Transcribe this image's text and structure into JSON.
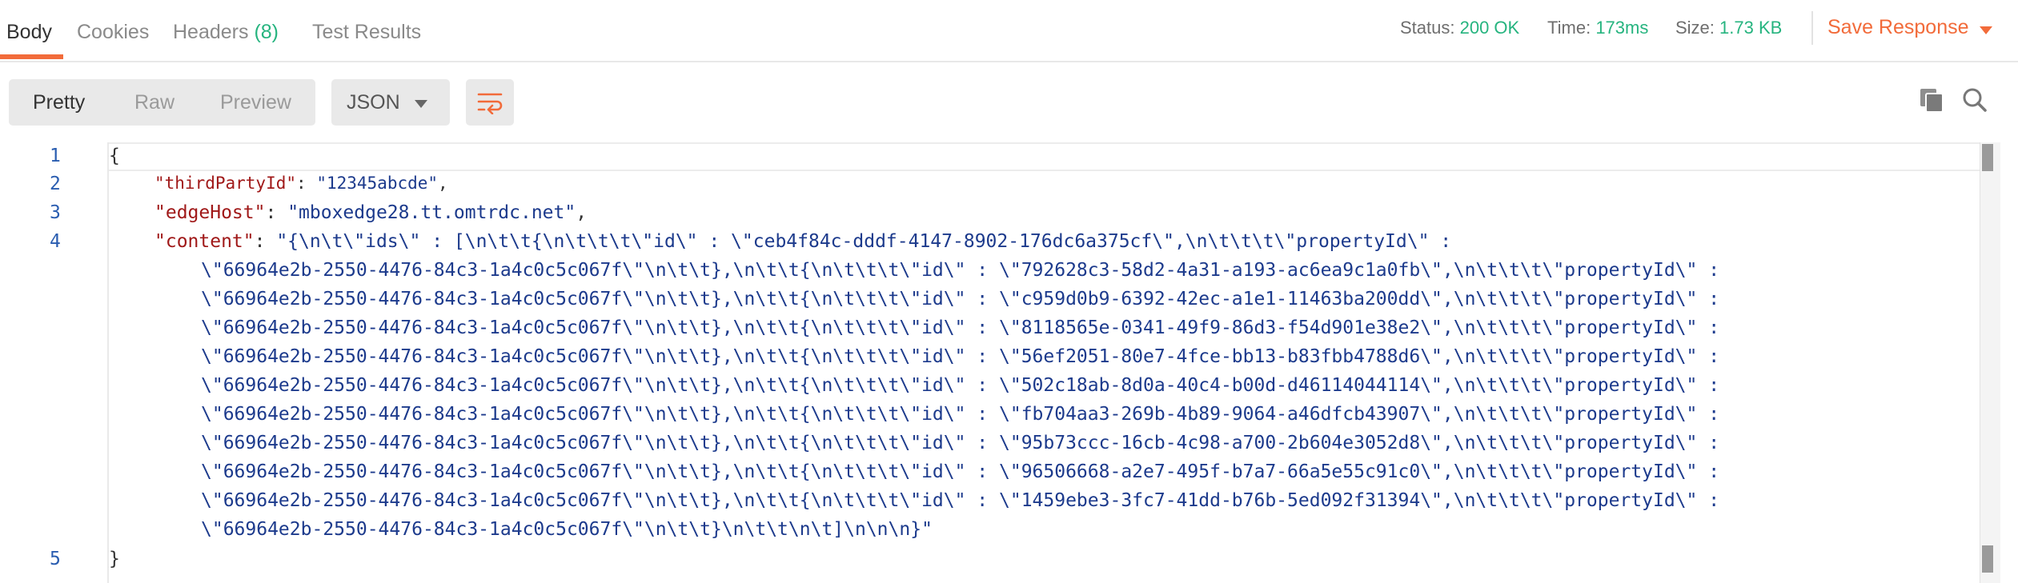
{
  "tabs": {
    "body": "Body",
    "cookies": "Cookies",
    "headers": "Headers",
    "headers_count": "(8)",
    "test_results": "Test Results"
  },
  "status": {
    "status_label": "Status:",
    "status_value": "200 OK",
    "time_label": "Time:",
    "time_value": "173ms",
    "size_label": "Size:",
    "size_value": "1.73 KB",
    "save_response": "Save Response"
  },
  "toolbar": {
    "pretty": "Pretty",
    "raw": "Raw",
    "preview": "Preview",
    "format": "JSON",
    "icons": [
      "wrap-lines-icon",
      "copy-icon",
      "search-icon"
    ]
  },
  "colors": {
    "accent": "#f26b3a",
    "success": "#26b47f",
    "json_key": "#a01919",
    "json_string": "#1c3a8c"
  },
  "editor": {
    "line_numbers": [
      "1",
      "2",
      "3",
      "4",
      "5"
    ],
    "open_brace": "{",
    "close_brace": "}",
    "line2_key": "\"thirdPartyId\"",
    "line2_value": "\"12345abcde\"",
    "line3_key": "\"edgeHost\"",
    "line3_value": "\"mboxedge28.tt.omtrdc.net\"",
    "line4_key": "\"content\"",
    "content_wrapped_lines": [
      "\"{\\n\\t\\\"ids\\\" : [\\n\\t\\t{\\n\\t\\t\\t\\\"id\\\" : \\\"ceb4f84c-dddf-4147-8902-176dc6a375cf\\\",\\n\\t\\t\\t\\\"propertyId\\\" :",
      "\\\"66964e2b-2550-4476-84c3-1a4c0c5c067f\\\"\\n\\t\\t},\\n\\t\\t{\\n\\t\\t\\t\\\"id\\\" : \\\"792628c3-58d2-4a31-a193-ac6ea9c1a0fb\\\",\\n\\t\\t\\t\\\"propertyId\\\" :",
      "\\\"66964e2b-2550-4476-84c3-1a4c0c5c067f\\\"\\n\\t\\t},\\n\\t\\t{\\n\\t\\t\\t\\\"id\\\" : \\\"c959d0b9-6392-42ec-a1e1-11463ba200dd\\\",\\n\\t\\t\\t\\\"propertyId\\\" :",
      "\\\"66964e2b-2550-4476-84c3-1a4c0c5c067f\\\"\\n\\t\\t},\\n\\t\\t{\\n\\t\\t\\t\\\"id\\\" : \\\"8118565e-0341-49f9-86d3-f54d901e38e2\\\",\\n\\t\\t\\t\\\"propertyId\\\" :",
      "\\\"66964e2b-2550-4476-84c3-1a4c0c5c067f\\\"\\n\\t\\t},\\n\\t\\t{\\n\\t\\t\\t\\\"id\\\" : \\\"56ef2051-80e7-4fce-bb13-b83fbb4788d6\\\",\\n\\t\\t\\t\\\"propertyId\\\" :",
      "\\\"66964e2b-2550-4476-84c3-1a4c0c5c067f\\\"\\n\\t\\t},\\n\\t\\t{\\n\\t\\t\\t\\\"id\\\" : \\\"502c18ab-8d0a-40c4-b00d-d46114044114\\\",\\n\\t\\t\\t\\\"propertyId\\\" :",
      "\\\"66964e2b-2550-4476-84c3-1a4c0c5c067f\\\"\\n\\t\\t},\\n\\t\\t{\\n\\t\\t\\t\\\"id\\\" : \\\"fb704aa3-269b-4b89-9064-a46dfcb43907\\\",\\n\\t\\t\\t\\\"propertyId\\\" :",
      "\\\"66964e2b-2550-4476-84c3-1a4c0c5c067f\\\"\\n\\t\\t},\\n\\t\\t{\\n\\t\\t\\t\\\"id\\\" : \\\"95b73ccc-16cb-4c98-a700-2b604e3052d8\\\",\\n\\t\\t\\t\\\"propertyId\\\" :",
      "\\\"66964e2b-2550-4476-84c3-1a4c0c5c067f\\\"\\n\\t\\t},\\n\\t\\t{\\n\\t\\t\\t\\\"id\\\" : \\\"96506668-a2e7-495f-b7a7-66a5e55c91c0\\\",\\n\\t\\t\\t\\\"propertyId\\\" :",
      "\\\"66964e2b-2550-4476-84c3-1a4c0c5c067f\\\"\\n\\t\\t},\\n\\t\\t{\\n\\t\\t\\t\\\"id\\\" : \\\"1459ebe3-3fc7-41dd-b76b-5ed092f31394\\\",\\n\\t\\t\\t\\\"propertyId\\\" :",
      "\\\"66964e2b-2550-4476-84c3-1a4c0c5c067f\\\"\\n\\t\\t}\\n\\t\\t\\n\\t]\\n\\n\\n}\""
    ]
  }
}
